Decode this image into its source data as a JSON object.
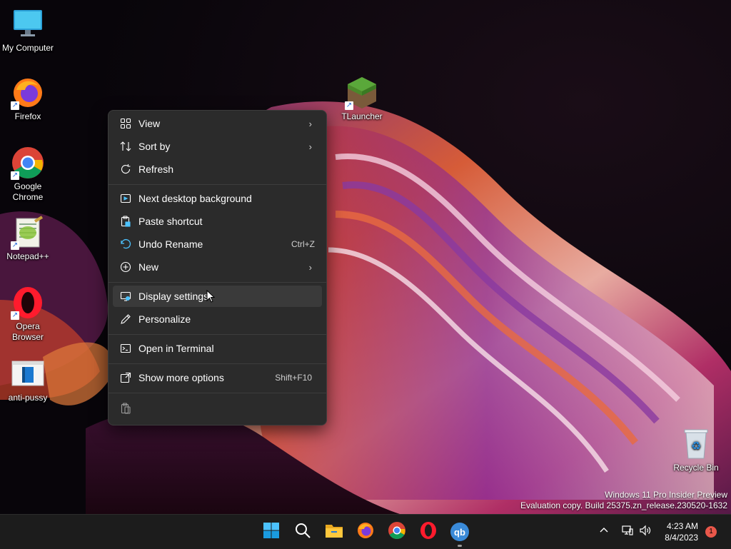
{
  "desktop": {
    "icons": [
      {
        "label": "My Computer",
        "icon": "monitor-icon",
        "shortcut": false
      },
      {
        "label": "Firefox",
        "icon": "firefox-icon",
        "shortcut": true
      },
      {
        "label": "Google Chrome",
        "icon": "chrome-icon",
        "shortcut": true
      },
      {
        "label": "Notepad++",
        "icon": "notepadpp-icon",
        "shortcut": true
      },
      {
        "label": "Opera Browser",
        "icon": "opera-icon",
        "shortcut": true
      },
      {
        "label": "anti-pussy",
        "icon": "app-icon",
        "shortcut": false
      },
      {
        "label": "TLauncher",
        "icon": "tlauncher-icon",
        "shortcut": true
      },
      {
        "label": "Recycle Bin",
        "icon": "recycle-bin-icon",
        "shortcut": false
      }
    ],
    "shortcut_glyph": "↗"
  },
  "context_menu": {
    "items": [
      {
        "label": "View",
        "submenu": true
      },
      {
        "label": "Sort by",
        "submenu": true
      },
      {
        "label": "Refresh"
      },
      {
        "label": "Next desktop background"
      },
      {
        "label": "Paste shortcut"
      },
      {
        "label": "Undo Rename",
        "shortcut": "Ctrl+Z"
      },
      {
        "label": "New",
        "submenu": true
      },
      {
        "label": "Display settings",
        "hovered": true
      },
      {
        "label": "Personalize"
      },
      {
        "label": "Open in Terminal"
      },
      {
        "label": "Show more options",
        "shortcut": "Shift+F10"
      }
    ],
    "arrow_glyph": "›"
  },
  "watermark": {
    "line1": "Windows 11 Pro Insider Preview",
    "line2": "Evaluation copy. Build 25375.zn_release.230520-1632"
  },
  "taskbar": {
    "apps": [
      "start-icon",
      "search-icon",
      "file-explorer-icon",
      "firefox-icon",
      "chrome-icon",
      "opera-icon",
      "qbittorrent-icon"
    ],
    "qbittorrent_label": "qb",
    "tray": {
      "chevron": "^",
      "time": "4:23 AM",
      "date": "8/4/2023",
      "notification_count": "1"
    }
  },
  "colors": {
    "menu_bg": "#2b2b2b",
    "taskbar_bg": "#1c1c1c",
    "accent": "#4cc2ff",
    "badge": "#e9574a"
  }
}
